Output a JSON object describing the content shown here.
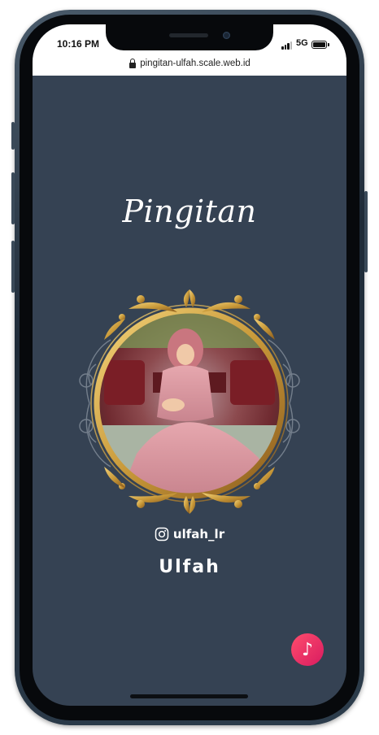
{
  "status_bar": {
    "time": "10:16 PM",
    "network": "5G"
  },
  "browser": {
    "url": "pingitan-ulfah.scale.web.id"
  },
  "page": {
    "title": "Pingitan",
    "instagram_handle": "ulfah_lr",
    "person_name": "Ulfah",
    "background_color": "#354253",
    "accent_gold": "#c99a3a"
  },
  "controls": {
    "music_button_icon": "music-note-icon",
    "music_button_glyph": "♪"
  }
}
